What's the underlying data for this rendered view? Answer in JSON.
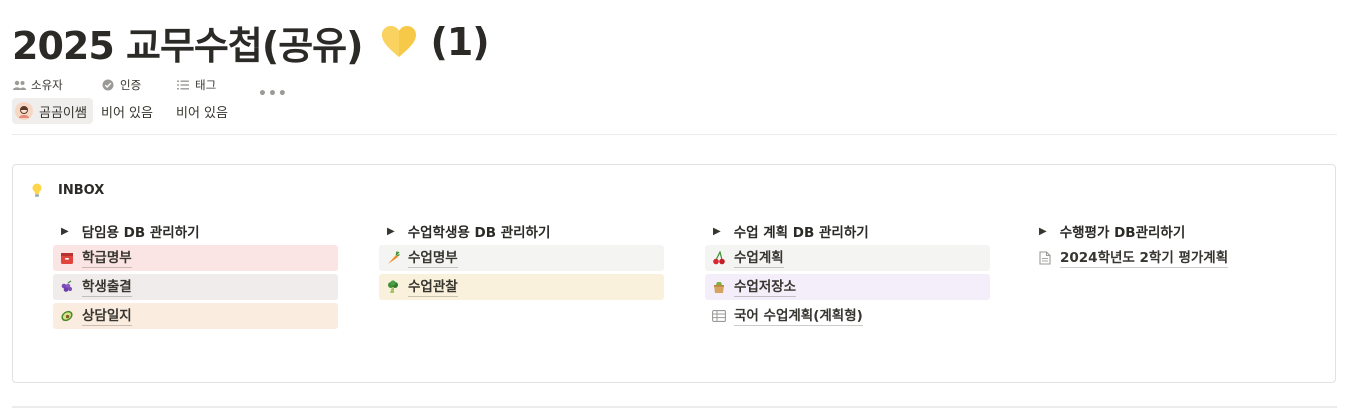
{
  "page": {
    "title": "2025 교무수첩(공유)",
    "title_suffix": "(1)",
    "title_icon": "yellow-heart-icon"
  },
  "properties": {
    "owner": {
      "label": "소유자",
      "icon": "people-icon",
      "value": "곰곰이쌤"
    },
    "verification": {
      "label": "인증",
      "icon": "verified-check-icon",
      "value": "비어 있음"
    },
    "tags": {
      "label": "태그",
      "icon": "list-icon",
      "value": "비어 있음"
    },
    "more": "•••"
  },
  "callout": {
    "icon": "lightbulb-icon",
    "title": "INBOX",
    "columns": [
      {
        "heading": "담임용 DB 관리하기",
        "items": [
          {
            "label": "학급명부",
            "icon": "red-cabinet-icon",
            "bg": "#fbe4e4"
          },
          {
            "label": "학생출결",
            "icon": "grapes-icon",
            "bg": "#efeceb"
          },
          {
            "label": "상담일지",
            "icon": "avocado-icon",
            "bg": "#fbece0"
          }
        ]
      },
      {
        "heading": "수업학생용 DB 관리하기",
        "items": [
          {
            "label": "수업명부",
            "icon": "carrot-icon",
            "bg": "#f4f4f2"
          },
          {
            "label": "수업관찰",
            "icon": "broccoli-icon",
            "bg": "#faf1dd"
          }
        ]
      },
      {
        "heading": "수업 계획 DB 관리하기",
        "items": [
          {
            "label": "수업계획",
            "icon": "cherries-icon",
            "bg": "#f4f4f2"
          },
          {
            "label": "수업저장소",
            "icon": "bag-icon",
            "bg": "#f3eefa"
          },
          {
            "label": "국어 수업계획(계획형)",
            "icon": "table-icon",
            "bg": "#ffffff"
          }
        ]
      },
      {
        "heading": "수행평가 DB관리하기",
        "items": [
          {
            "label": "2024학년도 2학기 평가계획",
            "icon": "page-icon",
            "bg": "#ffffff"
          }
        ]
      }
    ]
  }
}
